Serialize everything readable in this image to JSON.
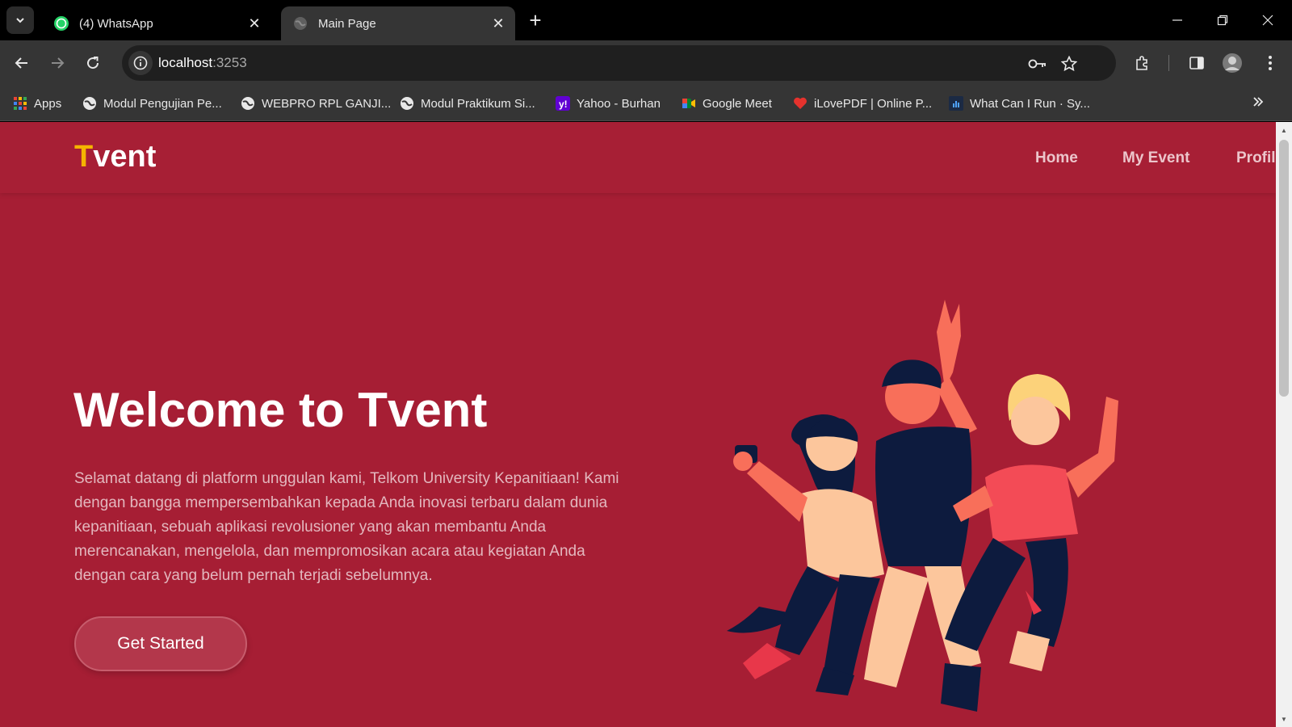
{
  "browser": {
    "tabs": [
      {
        "title": "(4) WhatsApp",
        "icon": "whatsapp-icon",
        "active": false
      },
      {
        "title": "Main Page",
        "icon": "globe-icon",
        "active": true
      }
    ],
    "address": {
      "host": "localhost",
      "port": ":3253"
    },
    "bookmarks": [
      {
        "label": "Apps",
        "icon": "apps-grid-icon"
      },
      {
        "label": "Modul Pengujian Pe...",
        "icon": "globe-icon"
      },
      {
        "label": "WEBPRO RPL GANJI...",
        "icon": "globe-icon"
      },
      {
        "label": "Modul Praktikum Si...",
        "icon": "globe-icon"
      },
      {
        "label": "Yahoo - Burhan",
        "icon": "yahoo-icon"
      },
      {
        "label": "Google Meet",
        "icon": "google-meet-icon"
      },
      {
        "label": "iLovePDF | Online P...",
        "icon": "heart-icon"
      },
      {
        "label": "What Can I Run · Sy...",
        "icon": "site-icon"
      }
    ]
  },
  "site": {
    "logo_first": "T",
    "logo_rest": "vent",
    "nav": [
      "Home",
      "My Event",
      "Profil"
    ],
    "hero_title": "Welcome to Tvent",
    "hero_text": "Selamat datang di platform unggulan kami, Telkom University Kepanitiaan! Kami dengan bangga mempersembahkan kepada Anda inovasi terbaru dalam dunia kepanitiaan, sebuah aplikasi revolusioner yang akan membantu Anda merencanakan, mengelola, dan mempromosikan acara atau kegiatan Anda dengan cara yang belum pernah terjadi sebelumnya.",
    "cta_label": "Get Started"
  },
  "colors": {
    "page_bg": "#a61e34",
    "logo_accent": "#f5b400",
    "button_bg": "#b3374b"
  }
}
